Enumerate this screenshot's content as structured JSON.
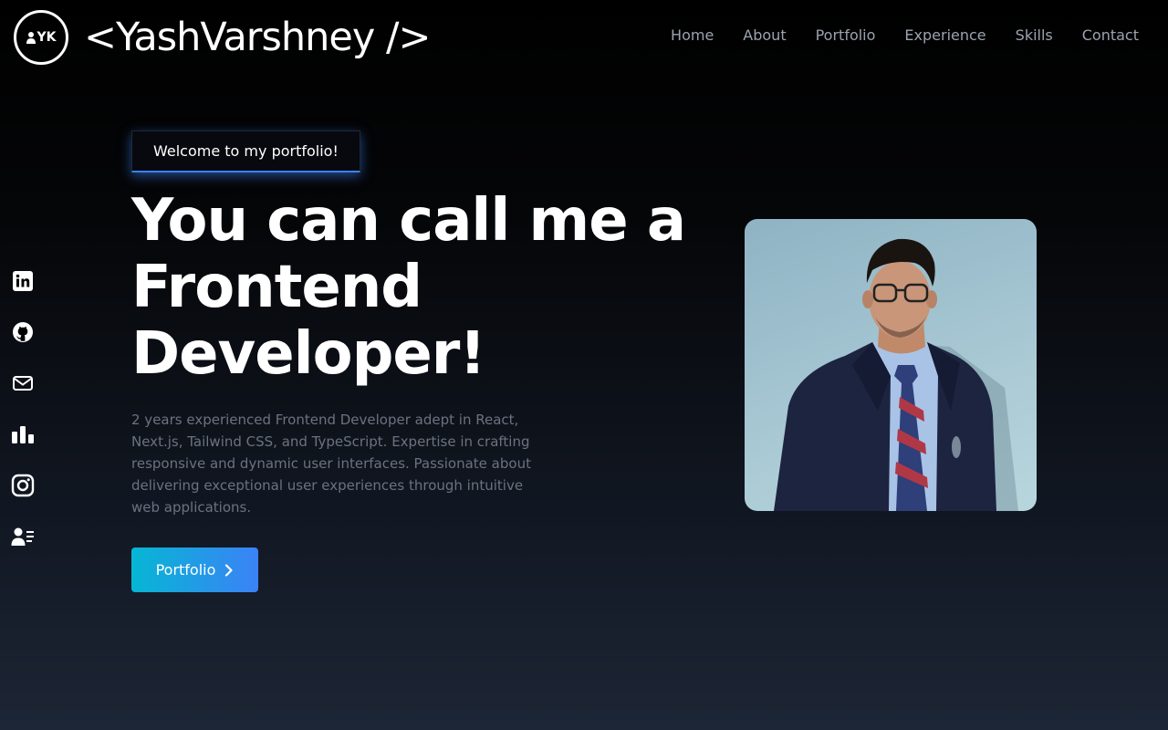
{
  "header": {
    "logo_text": "YK",
    "brand": "<YashVarshney />"
  },
  "nav": {
    "items": [
      "Home",
      "About",
      "Portfolio",
      "Experience",
      "Skills",
      "Contact"
    ]
  },
  "socials": [
    "linkedin-icon",
    "github-icon",
    "mail-icon",
    "stats-icon",
    "instagram-icon",
    "resume-icon"
  ],
  "hero": {
    "badge": "Welcome to my portfolio!",
    "title_lines": [
      "You can call me a",
      "Frontend",
      "Developer!"
    ],
    "description": "2 years experienced Frontend Developer adept in React, Next.js, Tailwind CSS, and TypeScript. Expertise in crafting responsive and dynamic user interfaces. Passionate about delivering exceptional user experiences through intuitive web applications.",
    "cta_label": "Portfolio"
  },
  "colors": {
    "accent_start": "#06b6d4",
    "accent_end": "#3b82f6",
    "nav_text": "#9ca3af",
    "description_text": "#6b7280"
  }
}
